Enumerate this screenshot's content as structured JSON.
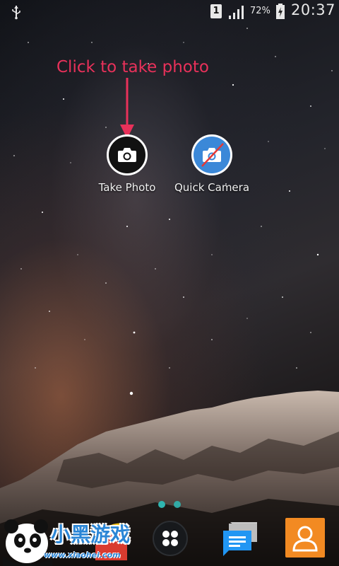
{
  "status_bar": {
    "usb_icon": "usb-icon",
    "sim_slot": "1",
    "signal_icon": "signal-bars-icon",
    "battery_percent": "72%",
    "battery_icon": "battery-charging-icon",
    "time": "20:37"
  },
  "annotation": {
    "text": "Click to take photo",
    "color": "#e8315a"
  },
  "home_apps": [
    {
      "label": "Take Photo",
      "icon": "camera-icon"
    },
    {
      "label": "Quick Camera",
      "icon": "camera-disabled-icon"
    }
  ],
  "page_indicator": {
    "pages": 2,
    "current": 1,
    "color": "#2fb5b0"
  },
  "dock": [
    {
      "icon": "chrome-icon"
    },
    {
      "icon": "app-drawer-icon"
    },
    {
      "icon": "messages-icon"
    },
    {
      "icon": "contacts-icon"
    }
  ],
  "watermark": {
    "logo": "panda-logo",
    "text": "小黑游戏",
    "url": "www.xiaohei.com"
  }
}
